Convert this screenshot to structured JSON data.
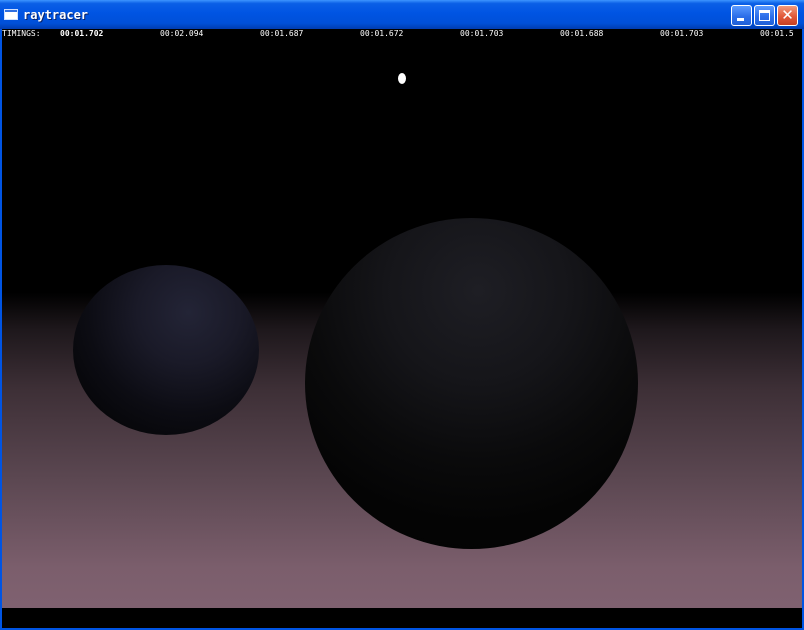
{
  "window": {
    "title": "raytracer"
  },
  "timings": {
    "label": "TIMINGS:",
    "values": [
      "00:01.702",
      "00:02.094",
      "00:01.687",
      "00:01.672",
      "00:01.703",
      "00:01.688",
      "00:01.703",
      "00:01.5"
    ]
  },
  "colors": {
    "titlebar": "#0054e3",
    "close_button": "#e2593a",
    "floor_far": "#3d2f36",
    "floor_near": "#7f6170",
    "sky": "#000000",
    "light": "#ffffff"
  },
  "icons": {
    "app": "window-icon",
    "minimize": "minimize-icon",
    "maximize": "maximize-icon",
    "close": "close-icon"
  }
}
